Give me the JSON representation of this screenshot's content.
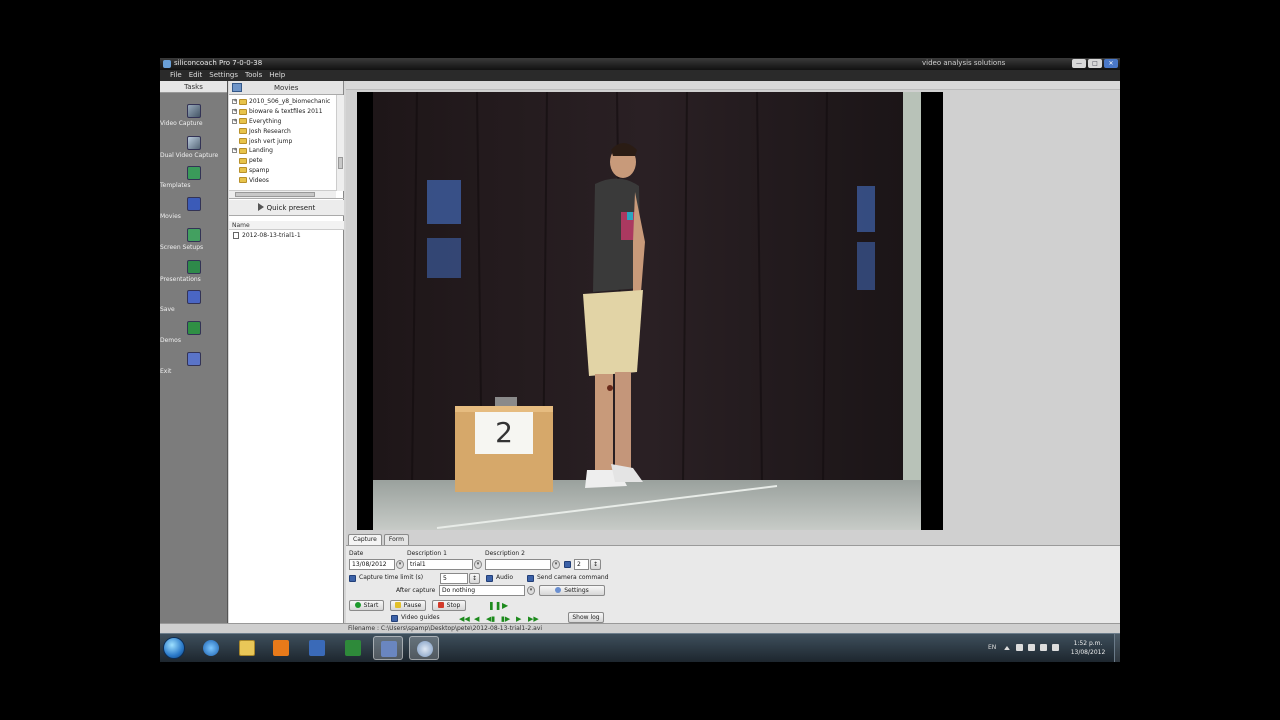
{
  "window": {
    "title": "siliconcoach Pro 7-0-0-38",
    "brand": "video analysis solutions",
    "buttons": [
      "—",
      "□",
      "✕"
    ]
  },
  "menu": [
    "File",
    "Edit",
    "Settings",
    "Tools",
    "Help"
  ],
  "tasks": {
    "header": "Tasks",
    "items": [
      {
        "label": "Video Capture",
        "icon": "video-capture-icon"
      },
      {
        "label": "Dual Video Capture",
        "icon": "dual-video-capture-icon"
      },
      {
        "label": "Templates",
        "icon": "templates-icon"
      },
      {
        "label": "Movies",
        "icon": "movies-icon"
      },
      {
        "label": "Screen Setups",
        "icon": "screen-setups-icon"
      },
      {
        "label": "Presentations",
        "icon": "presentations-icon"
      },
      {
        "label": "Save",
        "icon": "save-icon"
      },
      {
        "label": "Demos",
        "icon": "demos-icon"
      },
      {
        "label": "Exit",
        "icon": "exit-icon"
      }
    ]
  },
  "movies": {
    "header": "Movies",
    "tree": [
      {
        "label": "2010_S06_y8_biomechanic",
        "expandable": true
      },
      {
        "label": "bioware & textfiles 2011",
        "expandable": true
      },
      {
        "label": "Everything",
        "expandable": true
      },
      {
        "label": "Josh Research",
        "expandable": false
      },
      {
        "label": "josh vert jump",
        "expandable": false
      },
      {
        "label": "Landing",
        "expandable": true
      },
      {
        "label": "pete",
        "expandable": false
      },
      {
        "label": "spamp",
        "expandable": false
      },
      {
        "label": "Videos",
        "expandable": false
      }
    ],
    "quick_present": "Quick present",
    "list_header": "Name",
    "files": [
      "2012-08-13-trial1-1"
    ]
  },
  "video": {
    "box_number": "2"
  },
  "capture": {
    "tabs": [
      "Capture",
      "Form"
    ],
    "date_label": "Date",
    "date_value": "13/08/2012",
    "desc1_label": "Description 1",
    "desc1_value": "trial1",
    "desc2_label": "Description 2",
    "desc2_value": "",
    "count_value": "2",
    "capture_time_label": "Capture time limit (s)",
    "capture_time_value": "5",
    "audio_label": "Audio",
    "send_camera_label": "Send camera command",
    "after_capture_label": "After capture",
    "after_capture_value": "Do nothing",
    "settings_label": "Settings",
    "start_label": "Start",
    "pause_label": "Pause",
    "stop_label": "Stop",
    "video_guides_label": "Video guides",
    "show_log_label": "Show log"
  },
  "status": {
    "filename": "Filename : C:\\Users\\spamp\\Desktop\\pete\\2012-08-13-trial1-2.avi"
  },
  "taskbar": {
    "apps": [
      "start-orb",
      "internet-explorer-icon",
      "file-explorer-icon",
      "media-player-icon",
      "outlook-icon",
      "excel-icon",
      "save-disk-icon",
      "siliconcoach-icon"
    ],
    "language": "EN",
    "time": "1:52 p.m.",
    "date": "13/08/2012"
  },
  "colors": {
    "sidebar": "#7c7c7c",
    "taskbar": "#2a3945",
    "accent_green": "#1c8a1c",
    "stop_red": "#d23a2a"
  }
}
